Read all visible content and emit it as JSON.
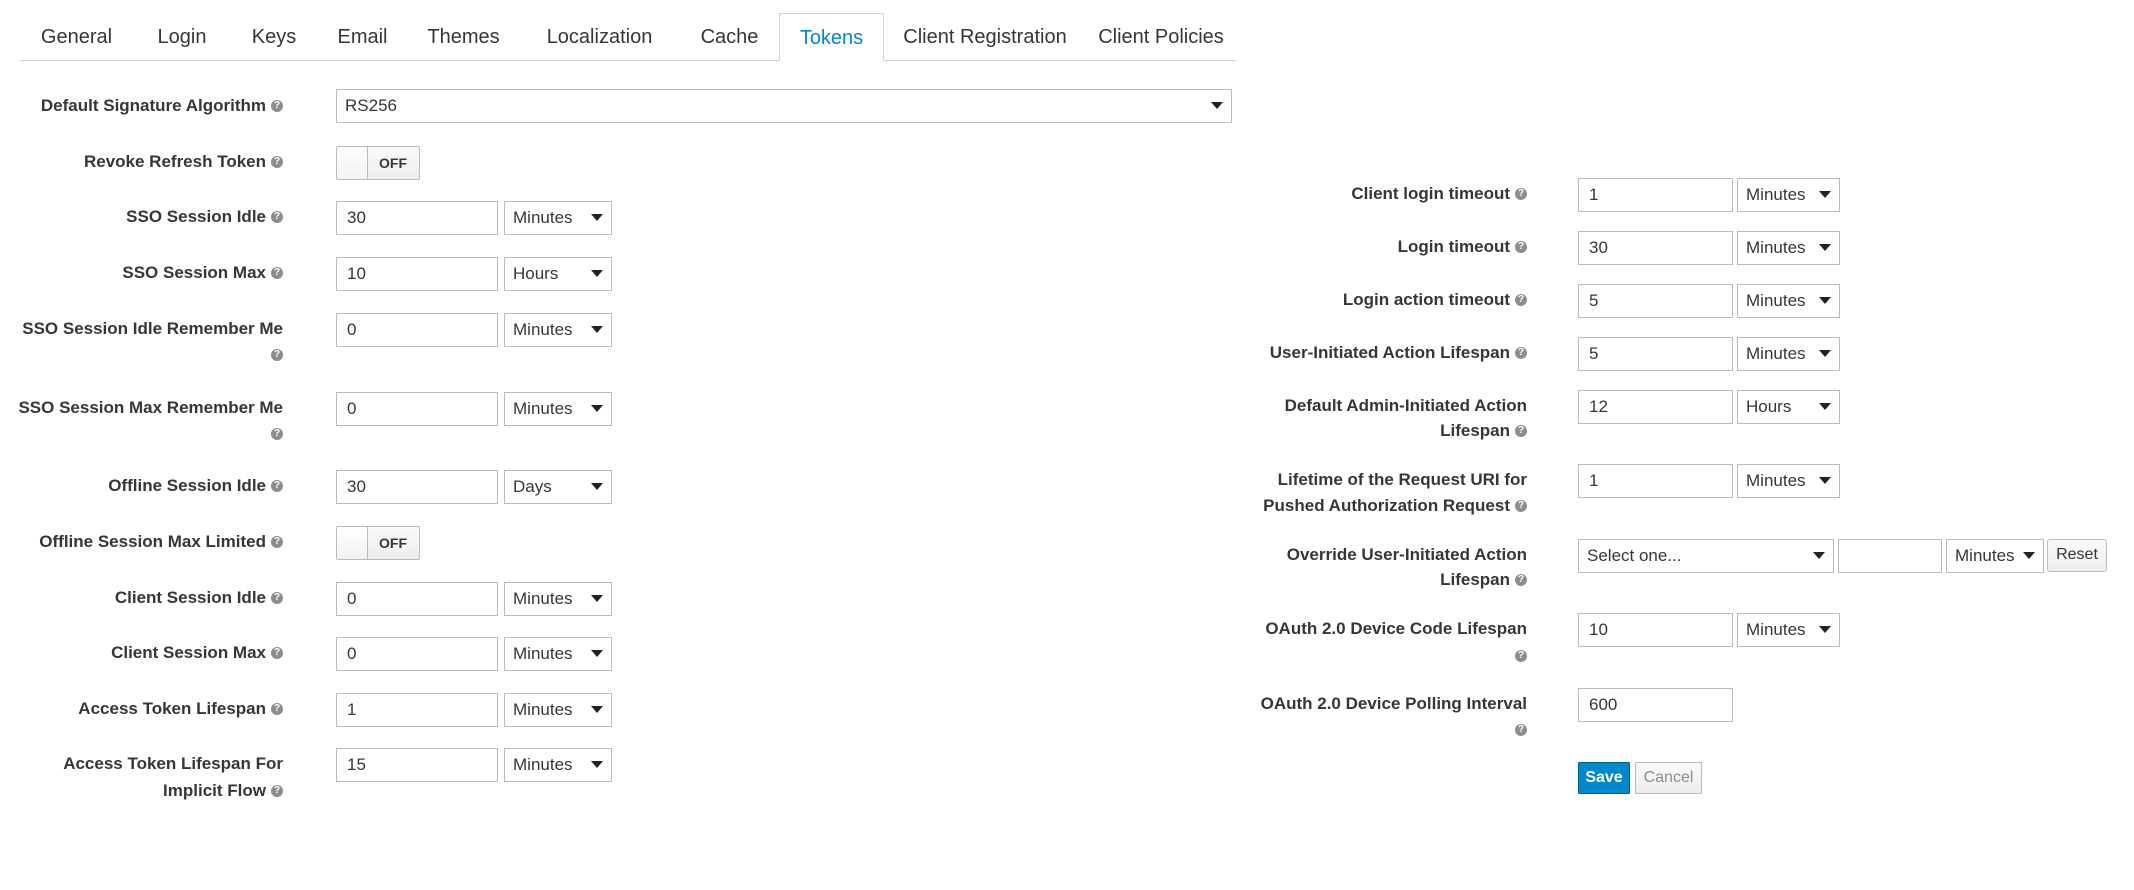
{
  "tabs": [
    {
      "label": "General"
    },
    {
      "label": "Login"
    },
    {
      "label": "Keys"
    },
    {
      "label": "Email"
    },
    {
      "label": "Themes"
    },
    {
      "label": "Localization"
    },
    {
      "label": "Cache"
    },
    {
      "label": "Tokens",
      "active": true
    },
    {
      "label": "Client Registration"
    },
    {
      "label": "Client Policies"
    }
  ],
  "left": {
    "default_sig_alg": {
      "label": "Default Signature Algorithm",
      "value": "RS256"
    },
    "revoke_refresh": {
      "label": "Revoke Refresh Token",
      "state": "OFF"
    },
    "sso_idle": {
      "label": "SSO Session Idle",
      "value": "30",
      "unit": "Minutes"
    },
    "sso_max": {
      "label": "SSO Session Max",
      "value": "10",
      "unit": "Hours"
    },
    "sso_idle_rm": {
      "label": "SSO Session Idle Remember Me",
      "value": "0",
      "unit": "Minutes"
    },
    "sso_max_rm": {
      "label": "SSO Session Max Remember Me",
      "value": "0",
      "unit": "Minutes"
    },
    "offline_idle": {
      "label": "Offline Session Idle",
      "value": "30",
      "unit": "Days"
    },
    "offline_max_limited": {
      "label": "Offline Session Max Limited",
      "state": "OFF"
    },
    "client_idle": {
      "label": "Client Session Idle",
      "value": "0",
      "unit": "Minutes"
    },
    "client_max": {
      "label": "Client Session Max",
      "value": "0",
      "unit": "Minutes"
    },
    "access_token": {
      "label": "Access Token Lifespan",
      "value": "1",
      "unit": "Minutes"
    },
    "access_token_implicit": {
      "label_1": "Access Token Lifespan For",
      "label_2": "Implicit Flow",
      "value": "15",
      "unit": "Minutes"
    }
  },
  "right": {
    "client_login": {
      "label": "Client login timeout",
      "value": "1",
      "unit": "Minutes"
    },
    "login": {
      "label": "Login timeout",
      "value": "30",
      "unit": "Minutes"
    },
    "login_action": {
      "label": "Login action timeout",
      "value": "5",
      "unit": "Minutes"
    },
    "user_action": {
      "label": "User-Initiated Action Lifespan",
      "value": "5",
      "unit": "Minutes"
    },
    "admin_action": {
      "label_1": "Default Admin-Initiated Action",
      "label_2": "Lifespan",
      "value": "12",
      "unit": "Hours"
    },
    "par": {
      "label_1": "Lifetime of the Request URI for",
      "label_2": "Pushed Authorization Request",
      "value": "1",
      "unit": "Minutes"
    },
    "override": {
      "label_1": "Override User-Initiated Action",
      "label_2": "Lifespan",
      "select": "Select one...",
      "value": "",
      "unit": "Minutes",
      "reset": "Reset"
    },
    "device_code": {
      "label": "OAuth 2.0 Device Code Lifespan",
      "value": "10",
      "unit": "Minutes"
    },
    "device_polling": {
      "label": "OAuth 2.0 Device Polling Interval",
      "value": "600"
    }
  },
  "actions": {
    "save": "Save",
    "cancel": "Cancel"
  },
  "colors": {
    "accent": "#0088ce",
    "label": "#363636",
    "border": "#bbbbbb",
    "help_icon": "#8b8d8f"
  },
  "icons": {
    "help": "question-circle-icon",
    "dropdown": "chevron-down-icon"
  }
}
